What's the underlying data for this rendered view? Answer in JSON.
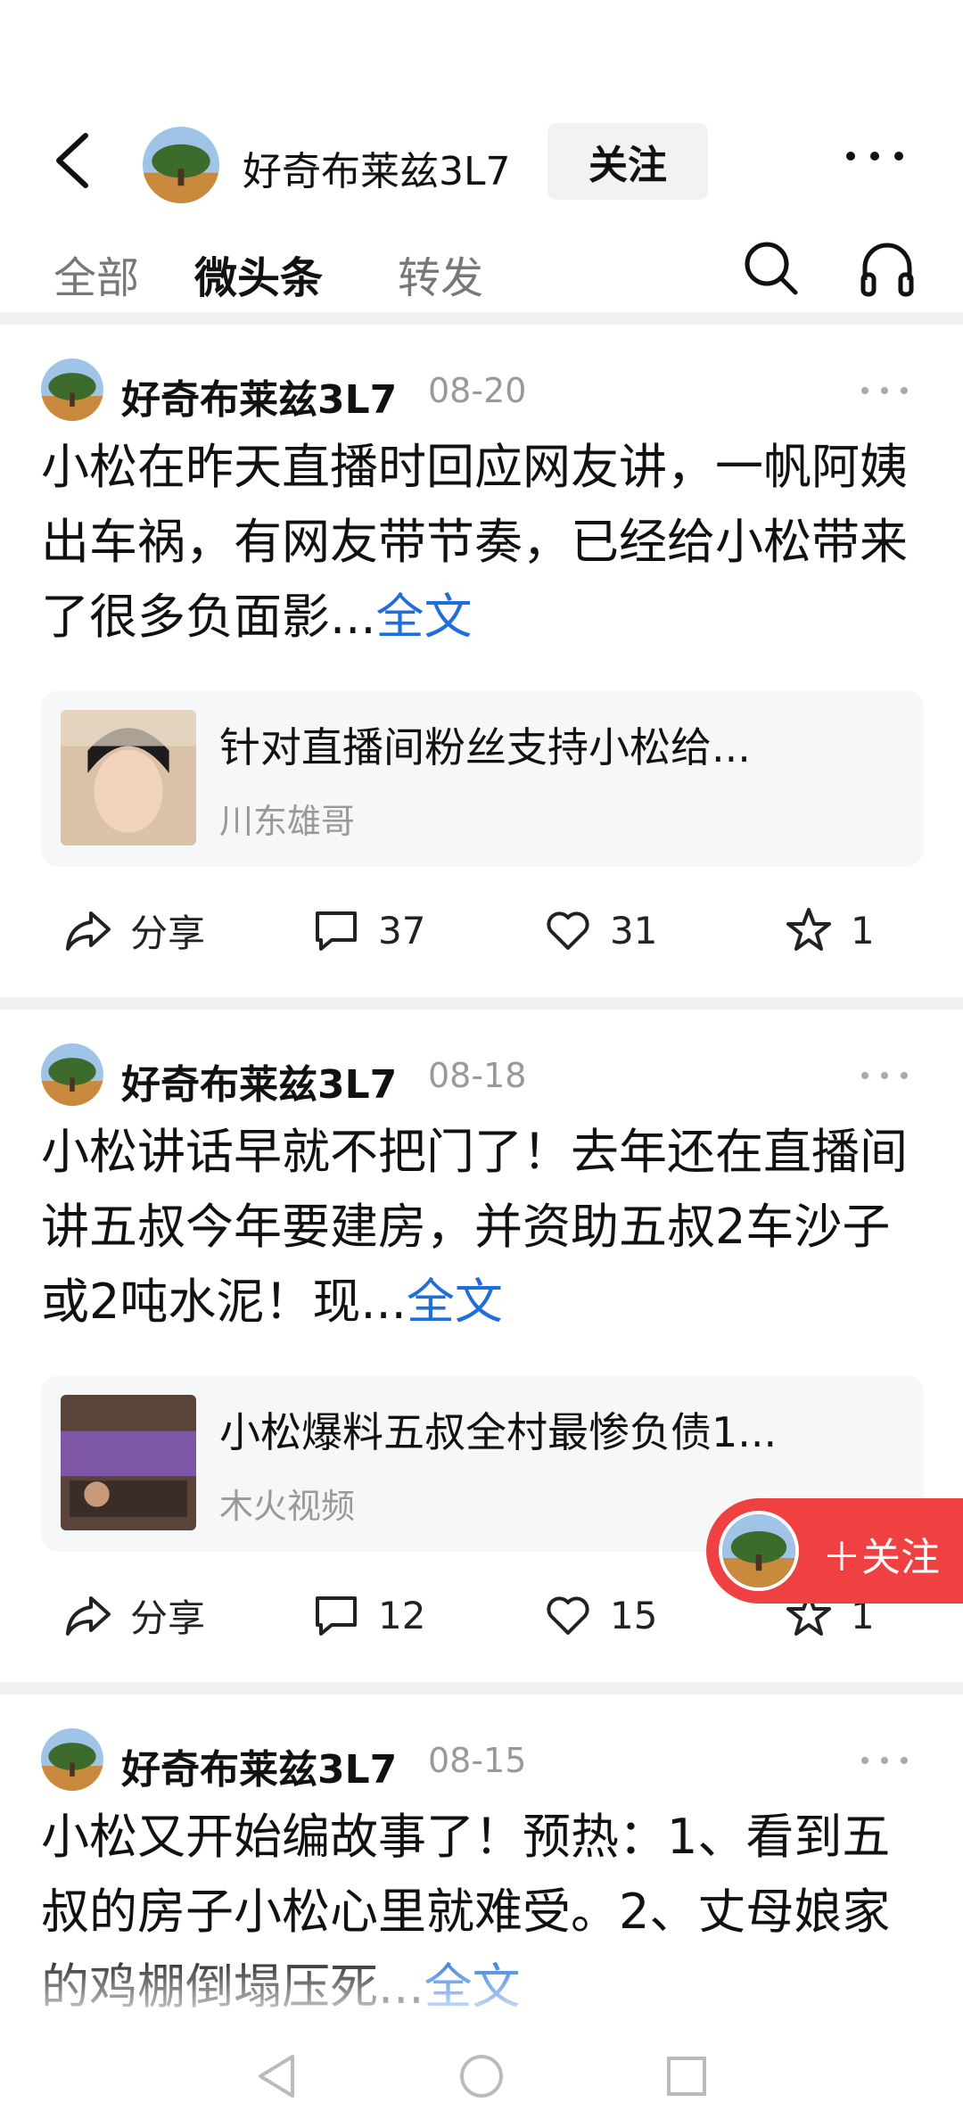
{
  "header": {
    "account_name": "好奇布莱兹3L7",
    "follow_label": "关注"
  },
  "tabs": [
    {
      "label": "全部",
      "active": false
    },
    {
      "label": "微头条",
      "active": true
    },
    {
      "label": "转发",
      "active": false
    }
  ],
  "posts": [
    {
      "author": "好奇布莱兹3L7",
      "date": "08-20",
      "text": "小松在昨天直播时回应网友讲，一帆阿姨出车祸，有网友带节奏，已经给小松带来了很多负面影...",
      "more_label": "全文",
      "quote": {
        "title": "针对直播间粉丝支持小松给...",
        "source": "川东雄哥"
      },
      "share_label": "分享",
      "comments": "37",
      "likes": "31",
      "favorites": "1"
    },
    {
      "author": "好奇布莱兹3L7",
      "date": "08-18",
      "text": "小松讲话早就不把门了！去年还在直播间讲五叔今年要建房，并资助五叔2车沙子或2吨水泥！现...",
      "more_label": "全文",
      "quote": {
        "title": "小松爆料五叔全村最惨负债1...",
        "source": "木火视频"
      },
      "share_label": "分享",
      "comments": "12",
      "likes": "15",
      "favorites": "1"
    },
    {
      "author": "好奇布莱兹3L7",
      "date": "08-15",
      "text": "小松又开始编故事了！预热：1、看到五叔的房子小松心里就难受。2、丈母娘家的鸡棚倒塌压死...",
      "more_label": "全文"
    }
  ],
  "float_follow": {
    "label": "＋关注"
  },
  "colors": {
    "accent_red": "#f04142",
    "link_blue": "#1f6fd8"
  }
}
